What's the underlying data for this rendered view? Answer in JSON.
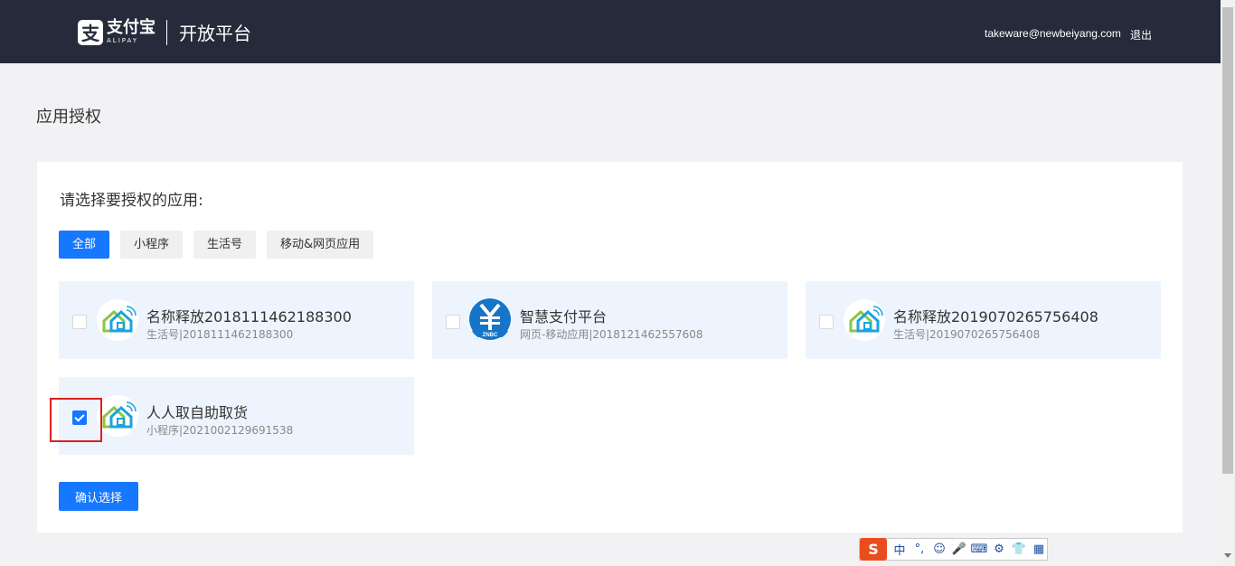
{
  "header": {
    "logo_mark": "支",
    "logo_cn": "支付宝",
    "logo_en": "ALIPAY",
    "platform_title": "开放平台",
    "user_email": "takeware@newbeiyang.com",
    "logout_label": "退出"
  },
  "page": {
    "title": "应用授权",
    "heading": "请选择要授权的应用:"
  },
  "filters": [
    {
      "label": "全部",
      "active": true
    },
    {
      "label": "小程序",
      "active": false
    },
    {
      "label": "生活号",
      "active": false
    },
    {
      "label": "移动&网页应用",
      "active": false
    }
  ],
  "apps": [
    {
      "name": "名称释放2018111462188300",
      "meta": "生活号|2018111462188300",
      "checked": false,
      "icon": "house-wifi-icon"
    },
    {
      "name": "智慧支付平台",
      "meta": "网页-移动应用|2018121462557608",
      "checked": false,
      "icon": "yuan-logo-icon"
    },
    {
      "name": "名称释放2019070265756408",
      "meta": "生活号|2019070265756408",
      "checked": false,
      "icon": "house-wifi-icon"
    },
    {
      "name": "人人取自助取货",
      "meta": "小程序|2021002129691538",
      "checked": true,
      "icon": "house-wifi-icon"
    }
  ],
  "confirm_label": "确认选择",
  "ime": {
    "logo": "S",
    "items": [
      "中",
      "°,",
      "☺",
      "🎤",
      "⌨",
      "⚙",
      "👕",
      "▦"
    ]
  },
  "colors": {
    "header_bg": "#252b3a",
    "accent": "#1677ff",
    "card_bg": "#eef4fd",
    "highlight": "#d9221c"
  }
}
